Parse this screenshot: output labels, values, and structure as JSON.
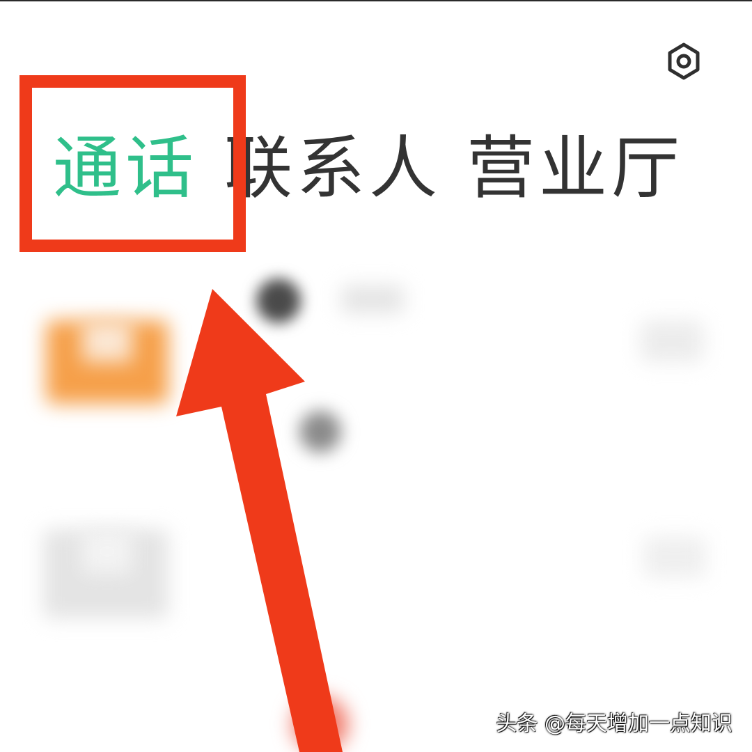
{
  "tabs": [
    {
      "label": "通话",
      "active": true
    },
    {
      "label": "联系人",
      "active": false
    },
    {
      "label": "营业厅",
      "active": false
    }
  ],
  "colors": {
    "active_tab": "#2fbf8a",
    "inactive_tab": "#333333",
    "annotation": "#ef3a1a",
    "gear": "#2f2f2f"
  },
  "icons": {
    "settings": "gear-icon"
  },
  "watermark": "头条 @每天增加一点知识"
}
